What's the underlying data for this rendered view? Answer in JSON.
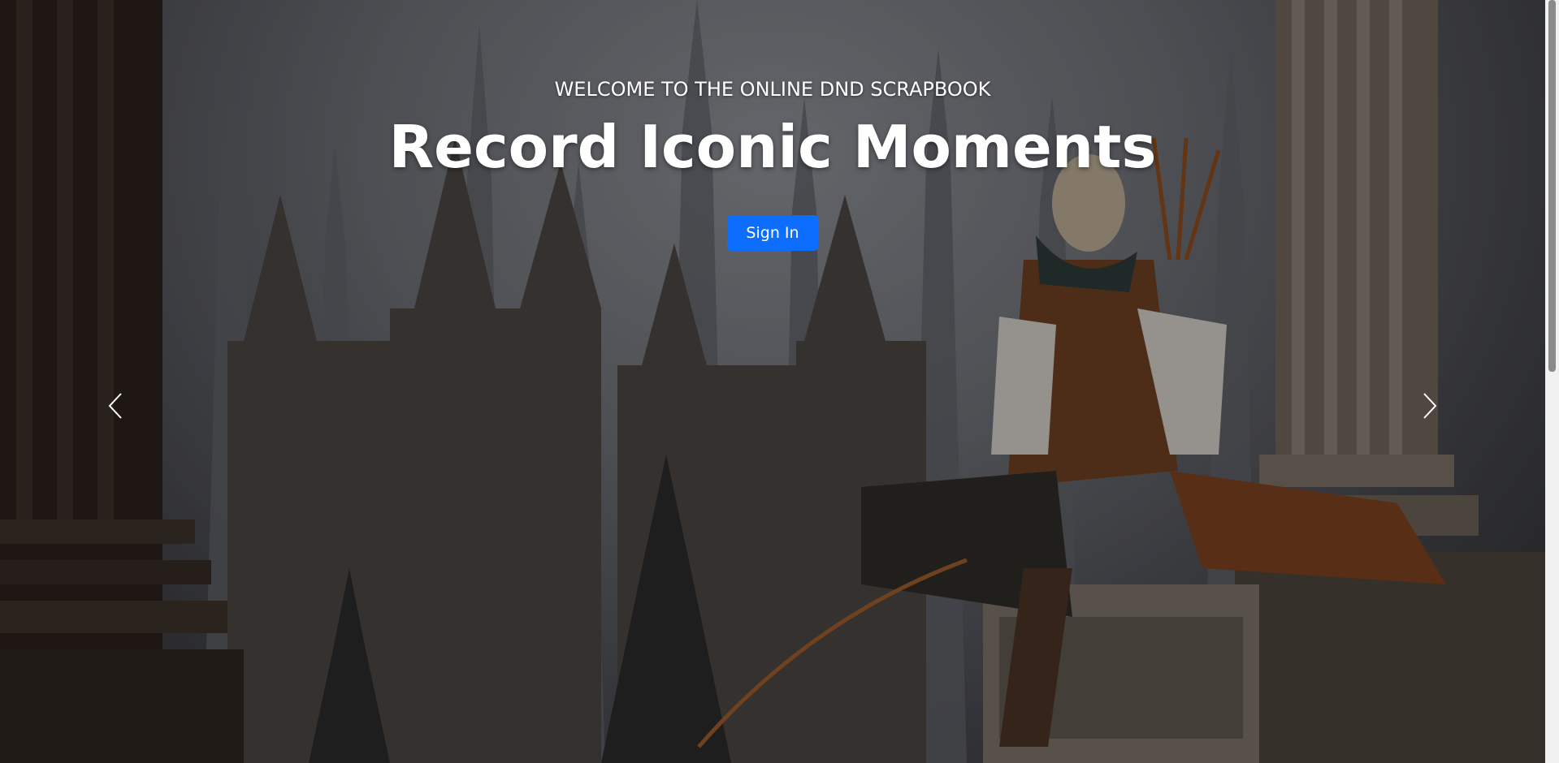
{
  "hero": {
    "eyebrow": "WELCOME TO THE ONLINE DND SCRAPBOOK",
    "headline": "Record Iconic Moments",
    "signin_label": "Sign In",
    "image_subject": "elf ranger seated on a balcony overlooking a gothic spired city"
  },
  "carousel": {
    "prev_icon": "chevron-left-icon",
    "next_icon": "chevron-right-icon"
  },
  "colors": {
    "primary_button": "#0d6efd",
    "text": "#ffffff"
  }
}
